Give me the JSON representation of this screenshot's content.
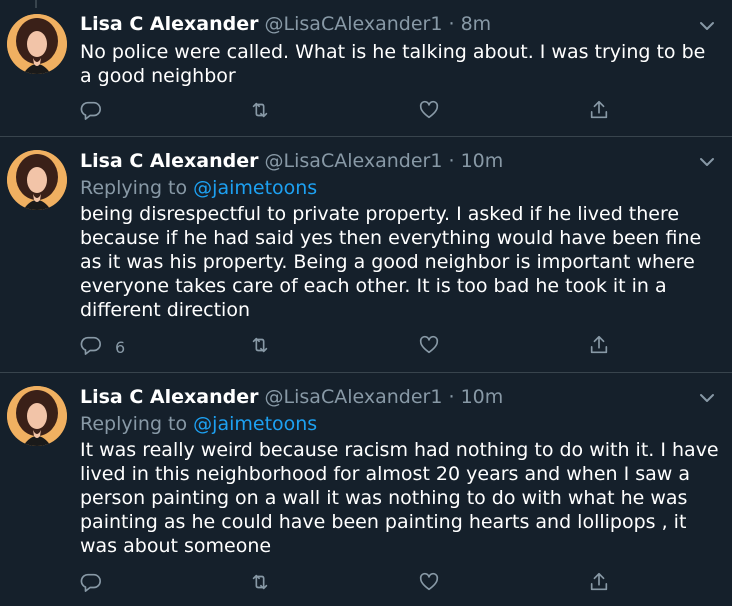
{
  "tweets": [
    {
      "name": "Lisa C Alexander",
      "handle": "@LisaCAlexander1",
      "separator": "·",
      "time": "8m",
      "replying_label": "",
      "replying_to": "",
      "text": "No police were called. What is he talking about. I was trying to be a good neighbor",
      "reply_count": ""
    },
    {
      "name": "Lisa C Alexander",
      "handle": "@LisaCAlexander1",
      "separator": "·",
      "time": "10m",
      "replying_label": "Replying to",
      "replying_to": "@jaimetoons",
      "text": "being disrespectful to private property. I asked if he lived there because if he had said yes then everything would have been fine as it was his property. Being a good neighbor is important where everyone takes care of each other. It is too bad he took it in a different direction",
      "reply_count": "6"
    },
    {
      "name": "Lisa C Alexander",
      "handle": "@LisaCAlexander1",
      "separator": "·",
      "time": "10m",
      "replying_label": "Replying to",
      "replying_to": "@jaimetoons",
      "text": "It was really weird because racism had nothing to do with it. I have lived in this neighborhood for almost 20 years and when I saw a person painting on a wall it was nothing to do with what he was painting as he could have been painting hearts and lollipops , it was about someone",
      "reply_count": ""
    }
  ],
  "colors": {
    "background": "#15202b",
    "divider": "#38444d",
    "muted": "#8899a6",
    "accent": "#1da1f2",
    "text": "#ffffff"
  },
  "icons": {
    "avatar": "avatar",
    "caret": "chevron-down-icon",
    "reply": "reply-icon",
    "retweet": "retweet-icon",
    "like": "heart-icon",
    "share": "share-icon"
  }
}
